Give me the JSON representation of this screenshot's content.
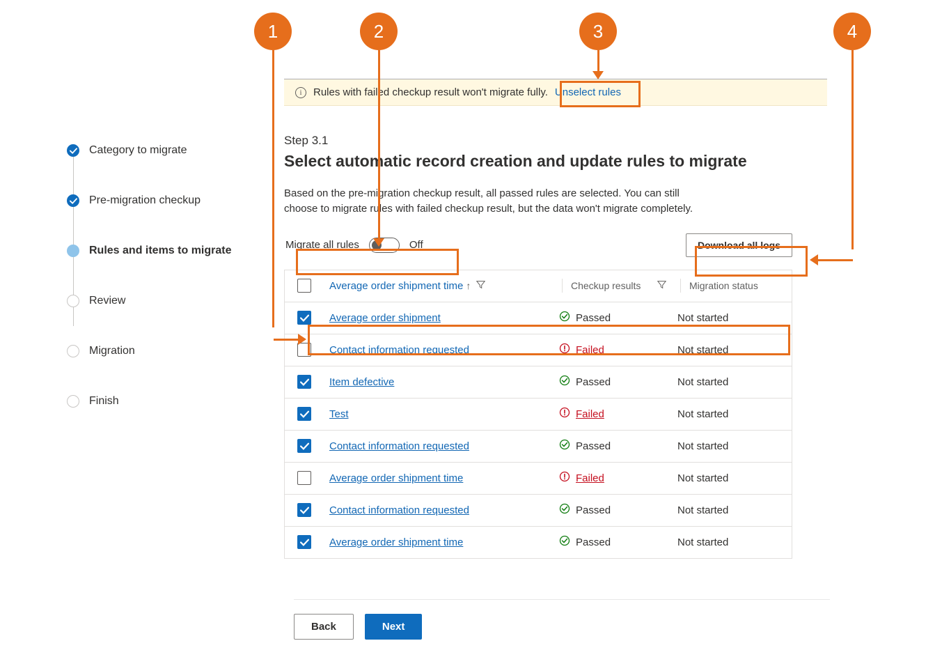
{
  "annotations": {
    "c1": "1",
    "c2": "2",
    "c3": "3",
    "c4": "4"
  },
  "sidebar": {
    "steps": [
      {
        "label": "Category to migrate",
        "state": "done"
      },
      {
        "label": "Pre-migration checkup",
        "state": "done"
      },
      {
        "label": "Rules and items to migrate",
        "state": "active"
      },
      {
        "label": "Review",
        "state": "pending"
      },
      {
        "label": "Migration",
        "state": "pending"
      },
      {
        "label": "Finish",
        "state": "pending"
      }
    ]
  },
  "banner": {
    "text": "Rules with failed checkup result won't migrate fully.",
    "link": "Unselect rules"
  },
  "step": {
    "num": "Step 3.1",
    "title": "Select automatic record creation and update rules to migrate",
    "desc": "Based on the pre-migration checkup result, all passed rules are selected. You can still choose to migrate rules with failed checkup result, but the data won't migrate completely."
  },
  "controls": {
    "toggle_label": "Migrate all rules",
    "toggle_state": "Off",
    "download_label": "Download all logs"
  },
  "table": {
    "headers": {
      "name": "Average order shipment time",
      "checkup": "Checkup results",
      "migration": "Migration status"
    },
    "rows": [
      {
        "checked": true,
        "name": "Average order shipment",
        "status": "Passed",
        "migration": "Not started"
      },
      {
        "checked": false,
        "name": "Contact information requested",
        "status": "Failed",
        "migration": "Not started"
      },
      {
        "checked": true,
        "name": "Item defective",
        "status": "Passed",
        "migration": "Not started"
      },
      {
        "checked": true,
        "name": "Test",
        "status": "Failed",
        "migration": "Not started"
      },
      {
        "checked": true,
        "name": "Contact information requested",
        "status": "Passed",
        "migration": "Not started"
      },
      {
        "checked": false,
        "name": "Average order shipment time",
        "status": "Failed",
        "migration": "Not started"
      },
      {
        "checked": true,
        "name": "Contact information requested",
        "status": "Passed",
        "migration": "Not started"
      },
      {
        "checked": true,
        "name": "Average order shipment time",
        "status": "Passed",
        "migration": "Not started"
      }
    ]
  },
  "footer": {
    "back": "Back",
    "next": "Next"
  }
}
